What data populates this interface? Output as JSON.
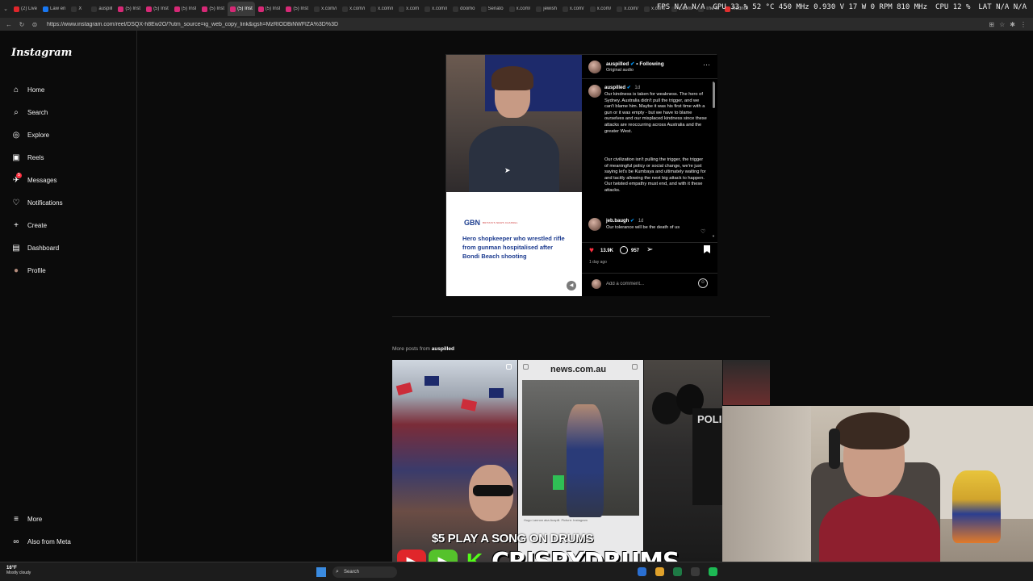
{
  "browser": {
    "tabs": [
      {
        "label": "(2) Live",
        "color": "#e0262b"
      },
      {
        "label": "Law en",
        "color": "#1877f2"
      },
      {
        "label": "X",
        "color": "#333333"
      },
      {
        "label": "auspill",
        "color": "#333333"
      },
      {
        "label": "(5) Inst",
        "color": "#d62976"
      },
      {
        "label": "(5) Inst",
        "color": "#d62976"
      },
      {
        "label": "(5) Inst",
        "color": "#d62976"
      },
      {
        "label": "(5) Inst",
        "color": "#d62976"
      },
      {
        "label": "(5) Inst",
        "color": "#d62976"
      },
      {
        "label": "(5) Inst",
        "color": "#d62976"
      },
      {
        "label": "(5) Inst",
        "color": "#d62976"
      },
      {
        "label": "x.com/i",
        "color": "#333333"
      },
      {
        "label": "x.com/i",
        "color": "#333333"
      },
      {
        "label": "x.com/i",
        "color": "#333333"
      },
      {
        "label": "x.com",
        "color": "#333333"
      },
      {
        "label": "x.com/i",
        "color": "#333333"
      },
      {
        "label": "doomo",
        "color": "#333333"
      },
      {
        "label": "Senato",
        "color": "#333333"
      },
      {
        "label": "x.com/",
        "color": "#333333"
      },
      {
        "label": "jewish",
        "color": "#333333"
      },
      {
        "label": "x.com/",
        "color": "#333333"
      },
      {
        "label": "x.com/",
        "color": "#333333"
      },
      {
        "label": "x.com/",
        "color": "#333333"
      },
      {
        "label": "x.com/",
        "color": "#333333"
      },
      {
        "label": "x.com/",
        "color": "#333333"
      },
      {
        "label": "The M",
        "color": "#333333"
      },
      {
        "label": "Rednot",
        "color": "#e02f2f"
      }
    ],
    "active_tab_index": 8,
    "url": "https://www.instagram.com/reel/DSQX-h8Ew2O/?utm_source=ig_web_copy_link&igsh=MzRlODBiNWFlZA%3D%3D",
    "overlay_stats": [
      "FPS N/A N/A",
      "GPU 33 % 52 °C 450 MHz 0.930 V 17 W 0 RPM 810 MHz",
      "CPU 12 %",
      "LAT N/A N/A"
    ]
  },
  "sidebar": {
    "logo": "Instagram",
    "items": [
      {
        "label": "Home",
        "icon": "home-icon",
        "glyph": "⌂"
      },
      {
        "label": "Search",
        "icon": "search-icon",
        "glyph": "⌕"
      },
      {
        "label": "Explore",
        "icon": "explore-icon",
        "glyph": "◎"
      },
      {
        "label": "Reels",
        "icon": "reels-icon",
        "glyph": "▣"
      },
      {
        "label": "Messages",
        "icon": "messages-icon",
        "glyph": "✈",
        "badge": "5"
      },
      {
        "label": "Notifications",
        "icon": "heart-icon",
        "glyph": "♡"
      },
      {
        "label": "Create",
        "icon": "plus-icon",
        "glyph": "+"
      },
      {
        "label": "Dashboard",
        "icon": "dashboard-icon",
        "glyph": "▤"
      },
      {
        "label": "Profile",
        "icon": "profile-avatar",
        "glyph": "●"
      }
    ],
    "bottom": [
      {
        "label": "More",
        "icon": "menu-icon",
        "glyph": "≡"
      },
      {
        "label": "Also from Meta",
        "icon": "meta-icon",
        "glyph": "∞"
      }
    ]
  },
  "post": {
    "username": "auspilled",
    "follow_state": "Following",
    "audio": "Original audio",
    "media_source_logo": "GBN",
    "media_source_sub": "BRITAIN'S NEWS CHANNEL",
    "media_headline": "Hero shopkeeper who wrestled rifle from gunman hospitalised after Bondi Beach shooting",
    "caption_time": "1d",
    "caption_p1": "Our kindness is taken for weakness. The hero of Sydney. Australia didn't pull the trigger, and we can't blame him. Maybe it was his first time with a gun or it was empty - but we have to blame ourselves and our misplaced kindness since these attacks are reoccurring across Australia and the greater West.",
    "caption_p2": "Our civilization isn't pulling the trigger, the trigger of meaningful policy or social change, we're just saying let's be Kumbaya and ultimately waiting for and tacitly allowing the next big attack to happen. Our twisted empathy must end, and with it these attacks.",
    "comment_user": "jeb.baugh",
    "comment_time": "1d",
    "comment_text": "Our tolerance will be the death of us",
    "likes": "13.9K",
    "comments": "957",
    "posted": "1 day ago",
    "add_comment_placeholder": "Add a comment..."
  },
  "more_posts": {
    "label": "More posts from",
    "username": "auspilled",
    "news_logo": "news.com.au",
    "news_caption": "Hugo Lannon aka Auspill. Picture: Instagram",
    "thumb3_text": "POLI"
  },
  "overlay": {
    "promo_text": "$5 PLAY A SONG ON DRUMS",
    "handle": "CRISPYDRUMS",
    "icons": [
      {
        "name": "youtube-icon",
        "color": "#e0262b",
        "glyph": "▶"
      },
      {
        "name": "rumble-icon",
        "color": "#55c22b",
        "glyph": "▶"
      },
      {
        "name": "kick-icon",
        "color": "#53fc18",
        "glyph": "K"
      }
    ]
  },
  "taskbar": {
    "temp": "16°F",
    "weather": "Mostly cloudy",
    "search_placeholder": "Search",
    "apps": [
      "#2a6fd1",
      "#e0a12b",
      "#1e7a45",
      "#3a3a3a",
      "#1db954"
    ]
  }
}
